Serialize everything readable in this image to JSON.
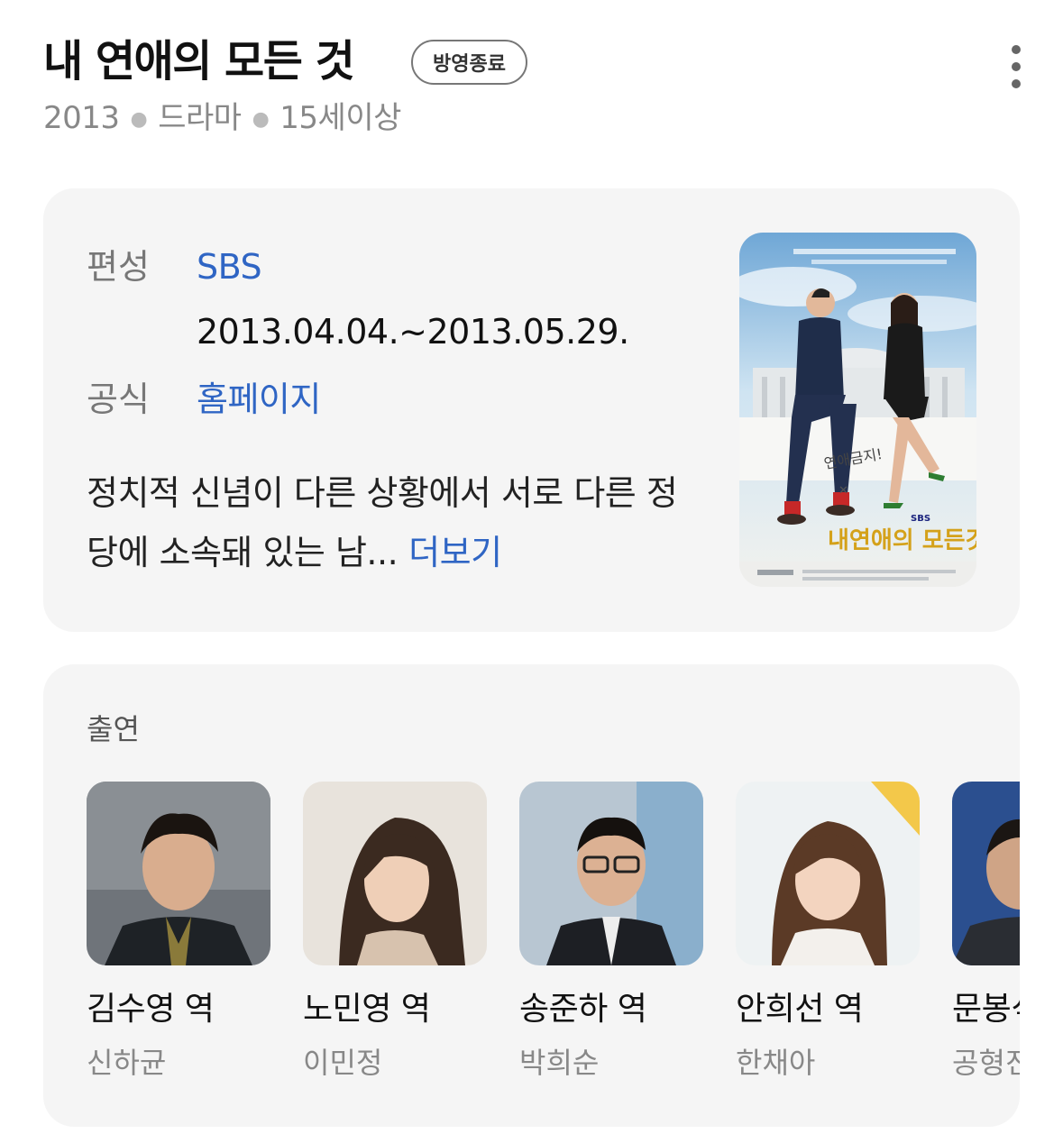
{
  "header": {
    "title": "내 연애의 모든 것",
    "status_badge": "방영종료",
    "year": "2013",
    "genre": "드라마",
    "rating": "15세이상",
    "more_icon": "vertical-ellipsis-icon"
  },
  "info": {
    "network_label": "편성",
    "network_value": "SBS",
    "air_period": "2013.04.04.~2013.05.29.",
    "official_label": "공식",
    "official_value": "홈페이지",
    "description": "정치적 신념이 다른 상황에서 서로 다른 정당에 소속돼 있는 남...",
    "more_link": "더보기",
    "poster": {
      "title_text": "내연애의 모든것",
      "network_logo": "SBS"
    }
  },
  "cast": {
    "heading": "출연",
    "members": [
      {
        "role": "김수영 역",
        "actor": "신하균"
      },
      {
        "role": "노민영 역",
        "actor": "이민정"
      },
      {
        "role": "송준하 역",
        "actor": "박희순"
      },
      {
        "role": "안희선 역",
        "actor": "한채아"
      },
      {
        "role": "문봉식 역",
        "actor": "공형진"
      }
    ]
  },
  "colors": {
    "link": "#2f65c4",
    "card_background": "#f5f5f5",
    "muted_text": "#888888"
  }
}
